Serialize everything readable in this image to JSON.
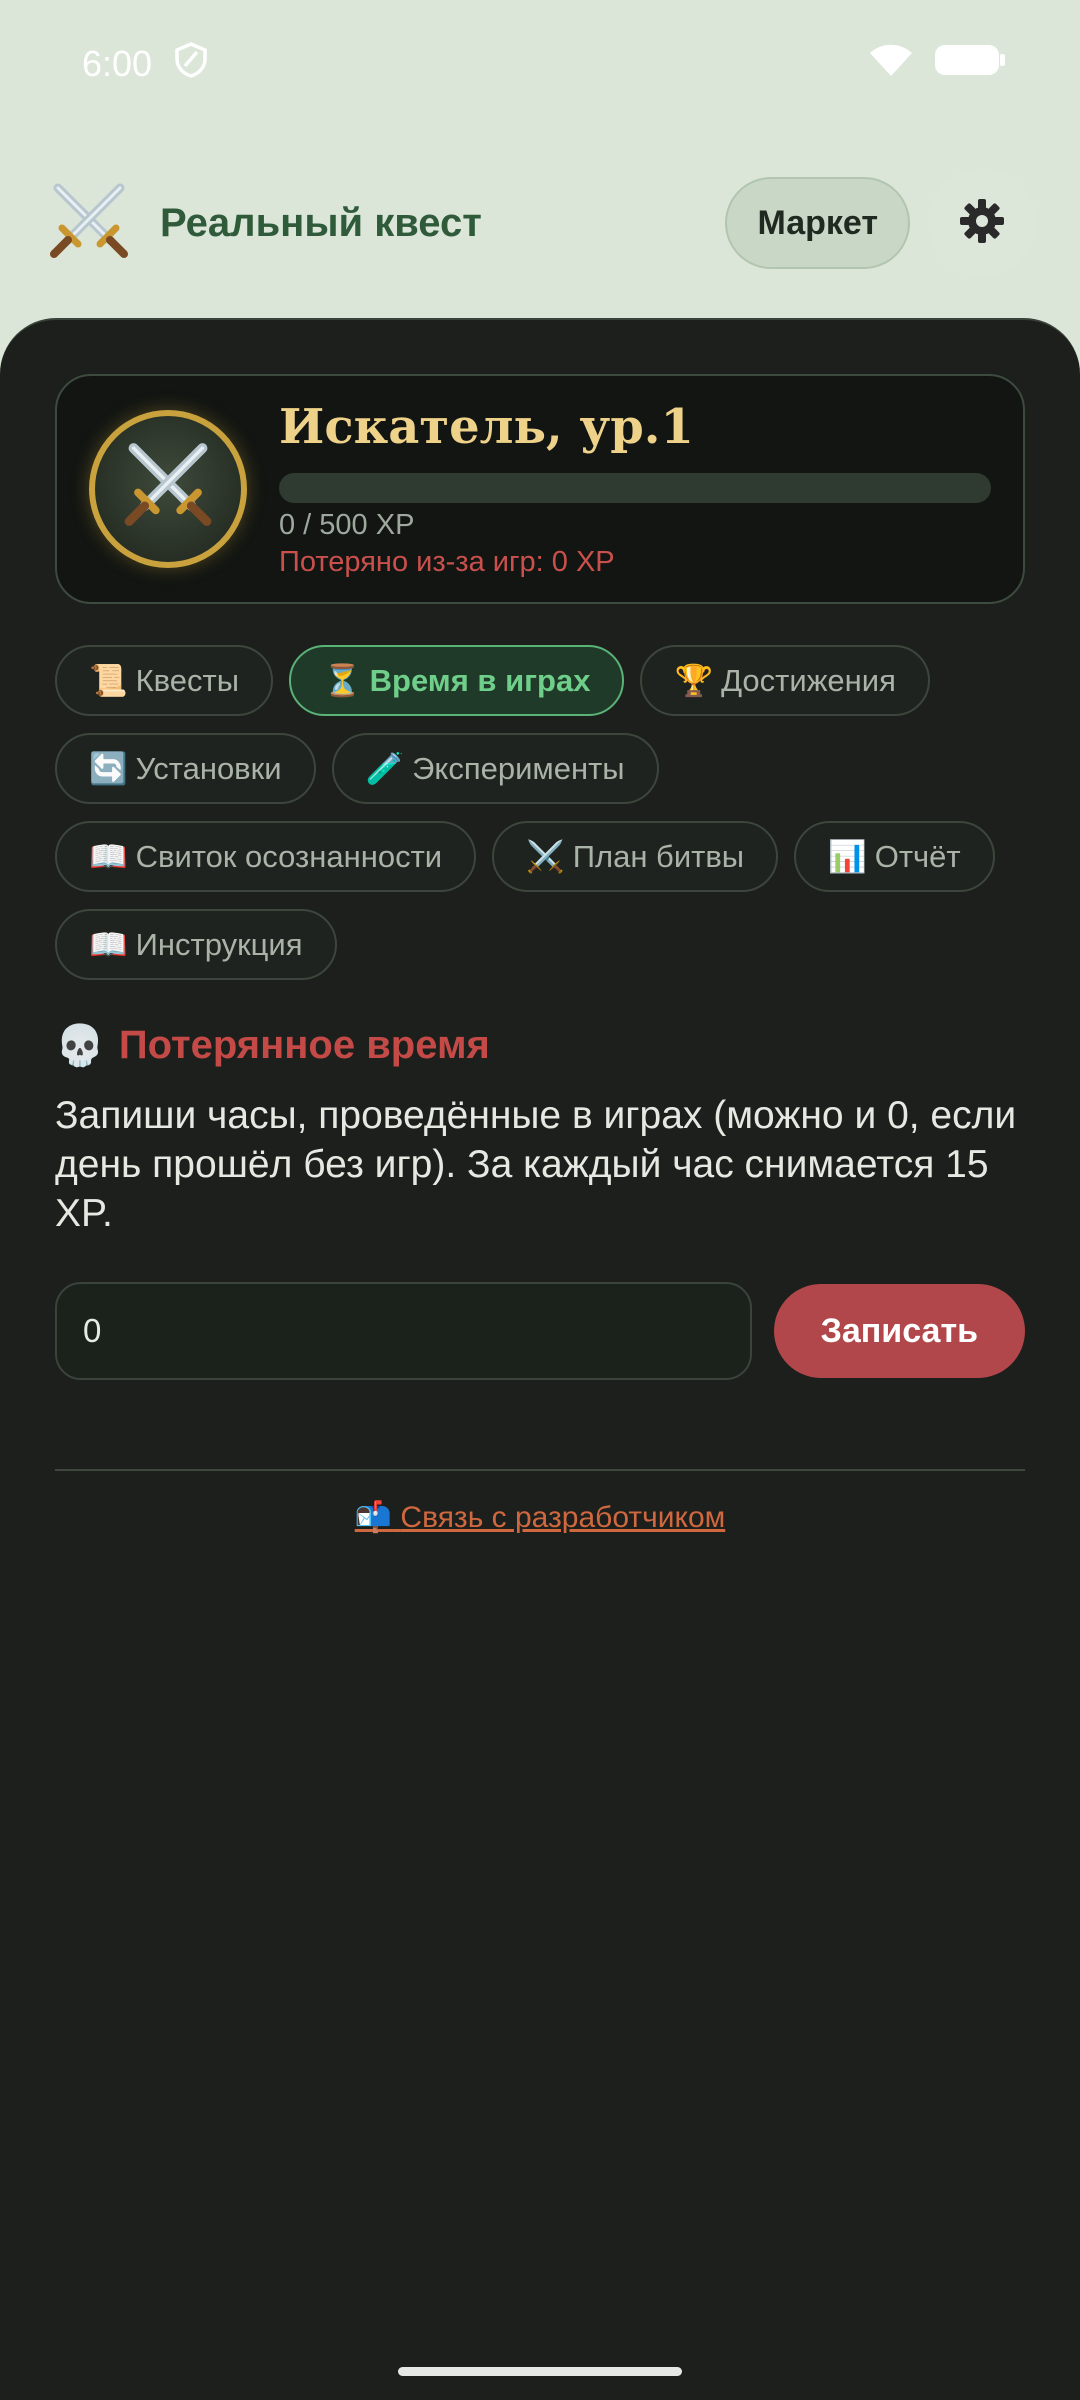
{
  "status_bar": {
    "time": "6:00"
  },
  "app_bar": {
    "title": "Реальный квест",
    "market_label": "Маркет"
  },
  "profile": {
    "rank": "Искатель, ур.1",
    "xp_text": "0 / 500 XP",
    "xp_progress": 0,
    "lost_text": "Потеряно из-за игр: 0 XP"
  },
  "tabs": [
    {
      "icon": "📜",
      "label": "Квесты"
    },
    {
      "icon": "⏳",
      "label": "Время в играх"
    },
    {
      "icon": "🏆",
      "label": "Достижения"
    },
    {
      "icon": "🔄",
      "label": "Установки"
    },
    {
      "icon": "🧪",
      "label": "Эксперименты"
    },
    {
      "icon": "📖",
      "label": "Свиток осознанности"
    },
    {
      "icon": "⚔️",
      "label": "План битвы"
    },
    {
      "icon": "📊",
      "label": "Отчёт"
    },
    {
      "icon": "📖",
      "label": "Инструкция"
    }
  ],
  "active_tab": "Время в играх",
  "section": {
    "icon": "💀",
    "title": "Потерянное время",
    "description": "Запиши часы, проведённые в играх (можно и 0, если день прошёл без игр). За каждый час снимается 15 XP."
  },
  "entry": {
    "value": "0",
    "button_label": "Записать"
  },
  "footer": {
    "icon": "📬",
    "contact_label": "Связь с разработчиком"
  },
  "colors": {
    "header_bg": "#dbe6d8",
    "content_bg": "#1c1f1b",
    "accent_green": "#6fcf8a",
    "danger_red": "#b2474b",
    "gold": "#efd28a"
  }
}
